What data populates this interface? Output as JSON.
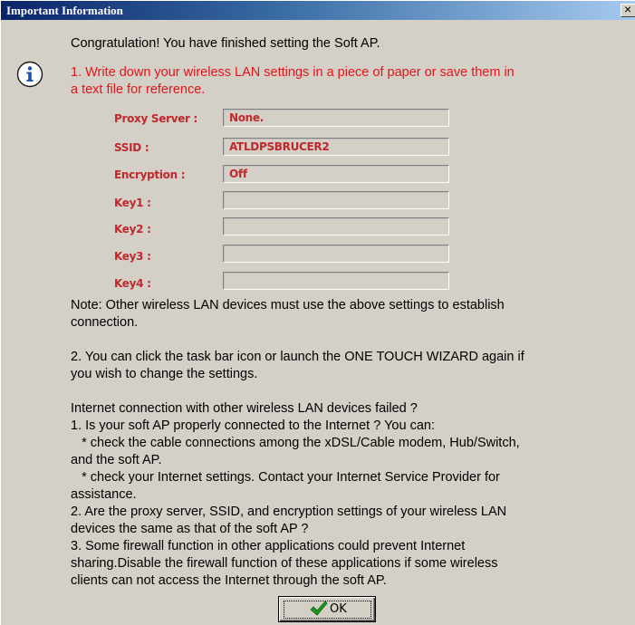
{
  "window": {
    "title": "Important Information",
    "close_glyph": "×"
  },
  "header_message": "Congratulation! You have finished setting the Soft AP.",
  "step1": {
    "line1": "1. Write down your wireless LAN settings in a piece of paper or save them in",
    "line2": "a text file for reference."
  },
  "fields": [
    {
      "label": "Proxy Server :",
      "value": "None."
    },
    {
      "label": "SSID :",
      "value": "ATLDPSBRUCER2"
    },
    {
      "label": "Encryption :",
      "value": "Off"
    },
    {
      "label": "Key1 :",
      "value": ""
    },
    {
      "label": "Key2 :",
      "value": ""
    },
    {
      "label": "Key3 :",
      "value": ""
    },
    {
      "label": "Key4 :",
      "value": ""
    }
  ],
  "note": {
    "line1": "Note: Other wireless LAN devices must use the above settings to establish",
    "line2": "connection."
  },
  "step2": {
    "line1": "2. You can click the task bar icon or launch the ONE TOUCH WIZARD again if",
    "line2": "you wish to change the settings."
  },
  "troubleshoot": [
    "Internet connection with other wireless LAN devices failed ?",
    "1. Is your soft AP properly connected to the Internet ? You can:",
    "   * check the cable connections among the xDSL/Cable modem, Hub/Switch,",
    "and the soft AP.",
    "   * check your Internet settings. Contact your Internet Service Provider for",
    "assistance.",
    "2. Are the proxy server, SSID, and encryption settings of your wireless LAN",
    "devices the same as that of the soft AP ?",
    "3. Some firewall function in other applications could prevent Internet",
    "sharing.Disable the firewall function of these applications if some wireless",
    "clients can not access the Internet through the soft AP."
  ],
  "ok_button": {
    "label": "OK",
    "icon": "checkmark-icon"
  },
  "colors": {
    "title_bar": "#0a246a",
    "highlight_red": "#e4141b",
    "field_red": "#c0282c",
    "dialog_bg": "#d4d0c8"
  }
}
